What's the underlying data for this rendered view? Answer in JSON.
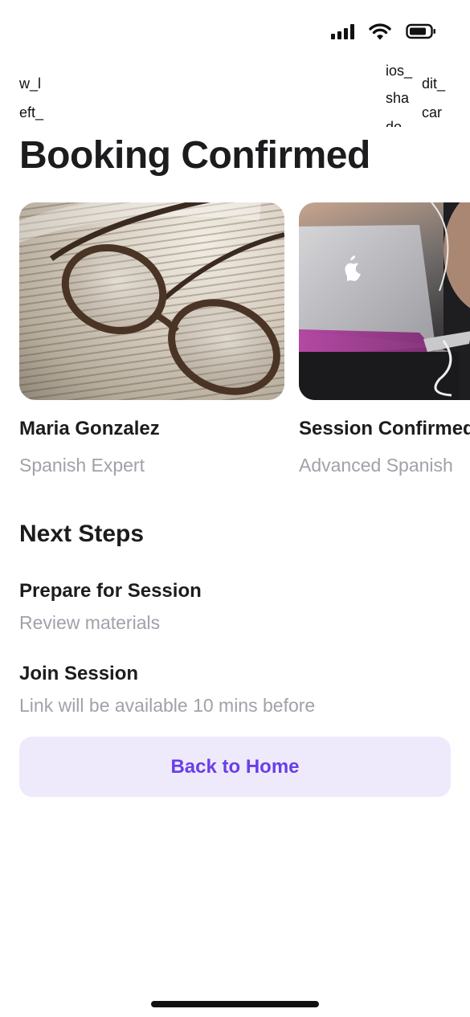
{
  "status_bar": {
    "icons": [
      "cellular-signal-icon",
      "wifi-icon",
      "battery-icon"
    ]
  },
  "alt_fragments": {
    "left": [
      "w_l",
      "eft_"
    ],
    "middle": [
      "ios_",
      "sha",
      "do"
    ],
    "right": [
      "dit_",
      "car"
    ]
  },
  "page": {
    "title": "Booking Confirmed"
  },
  "cards": [
    {
      "title": "Maria Gonzalez",
      "subtitle": "Spanish Expert",
      "image": "reading-glasses-on-book"
    },
    {
      "title": "Session Confirmed",
      "subtitle": "Advanced Spanish",
      "image": "person-with-laptop"
    }
  ],
  "next_steps": {
    "title": "Next Steps",
    "items": [
      {
        "title": "Prepare for Session",
        "subtitle": "Review materials"
      },
      {
        "title": "Join Session",
        "subtitle": "Link will be available 10 mins before"
      }
    ]
  },
  "actions": {
    "back_home_label": "Back to Home"
  },
  "colors": {
    "accent": "#6a3ee8",
    "button_bg": "#eeeafc",
    "muted_text": "#a1a1aa",
    "primary_text": "#1c1c1e"
  }
}
